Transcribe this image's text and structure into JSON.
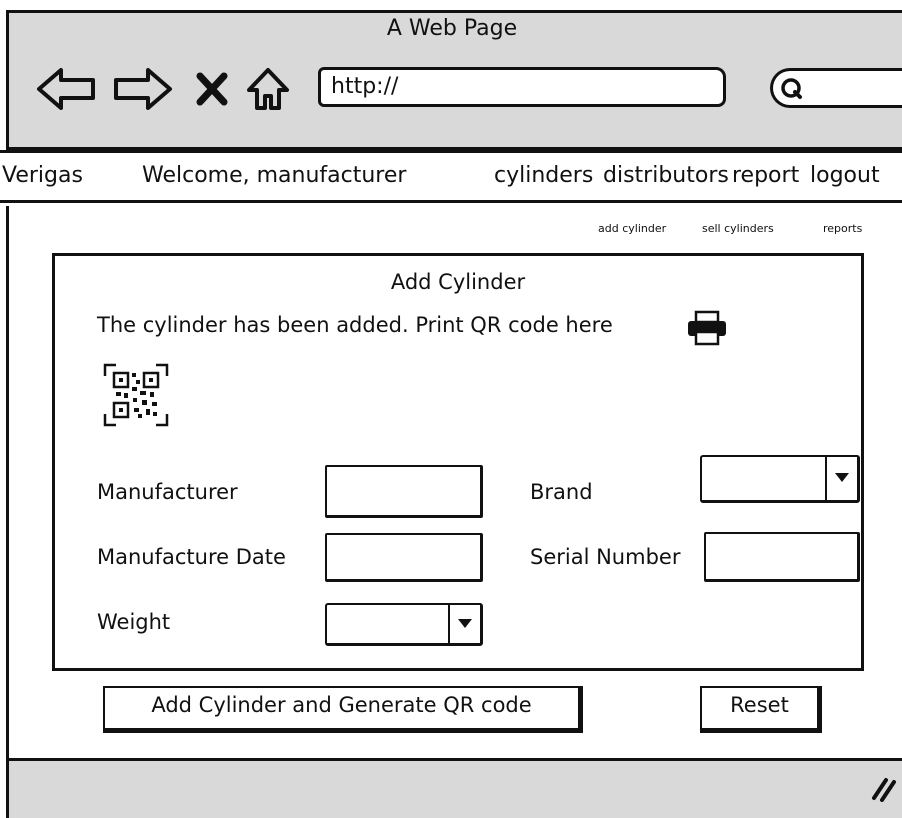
{
  "window": {
    "title": "A Web Page"
  },
  "browser": {
    "url": "http://",
    "icons": [
      "back-arrow-icon",
      "forward-arrow-icon",
      "stop-icon",
      "home-icon",
      "search-icon",
      "resize-grip-icon"
    ]
  },
  "menubar": {
    "brand": "Verigas",
    "welcome": "Welcome, manufacturer",
    "items": [
      "cylinders",
      "distributors",
      "report",
      "logout"
    ]
  },
  "sublinks": [
    "add cylinder",
    "sell cylinders",
    "reports"
  ],
  "form": {
    "title": "Add Cylinder",
    "message": "The cylinder has been added. Print QR code here",
    "fields": {
      "manufacturer": {
        "label": "Manufacturer",
        "value": ""
      },
      "manufacture_date": {
        "label": "Manufacture Date",
        "value": ""
      },
      "weight": {
        "label": "Weight",
        "value": ""
      },
      "brand": {
        "label": "Brand",
        "value": ""
      },
      "serial_number": {
        "label": "Serial Number",
        "value": ""
      }
    },
    "buttons": {
      "submit": "Add Cylinder and Generate QR code",
      "reset": "Reset"
    }
  }
}
